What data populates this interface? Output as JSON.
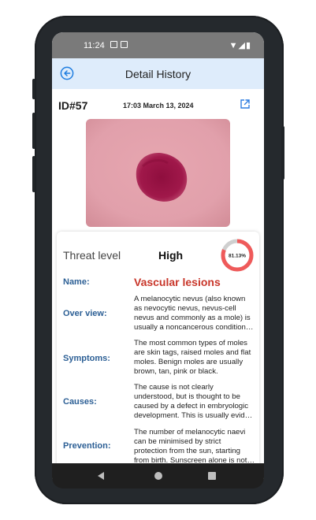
{
  "status_bar": {
    "time": "11:24"
  },
  "app_bar": {
    "title": "Detail History"
  },
  "record": {
    "id": "ID#57",
    "datetime": "17:03 March 13, 2024"
  },
  "threat": {
    "label": "Threat level",
    "value": "High",
    "percent_text": "81.13%",
    "percent": 81.13,
    "ring_color": "#ef5a5a",
    "track_color": "#cfcfcf"
  },
  "details": {
    "name_label": "Name:",
    "name_value": "Vascular lesions",
    "overview_label": "Over view:",
    "overview_text": "A melanocytic nevus (also known as nevocytic nevus, nevus-cell nevus and commonly as a mole) is usually a noncancerous condition of pigment-producing skin cells.",
    "symptoms_label": "Symptoms:",
    "symptoms_text": "The most common types of moles are skin tags, raised moles and flat moles. Benign moles are usually brown, tan, pink or black.",
    "causes_label": "Causes:",
    "causes_text": "The cause is not clearly understood, but is thought to be caused by a defect in embryologic development. This is usually evident at birth.",
    "prevention_label": "Prevention:",
    "prevention_text": "The number of melanocytic naevi can be minimised by strict protection from the sun, starting from birth. Sunscreen alone is not enough."
  },
  "icons": {
    "back": "back-arrow-circle-icon",
    "share": "share-icon"
  },
  "colors": {
    "appbar": "#deecfb",
    "label_blue": "#2c5f95",
    "name_red": "#c8362a"
  }
}
